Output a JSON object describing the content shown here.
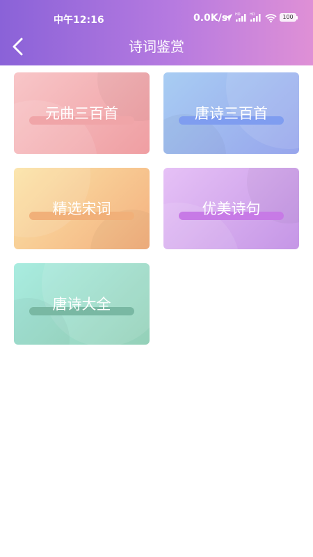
{
  "status_bar": {
    "time": "中午12:16",
    "speed": "0.0K/s",
    "battery": "100"
  },
  "header": {
    "title": "诗词鉴赏",
    "back_icon": "chevron-left-icon"
  },
  "cards": [
    {
      "label": "元曲三百首",
      "bar_color": "#f0a5a8"
    },
    {
      "label": "唐诗三百首",
      "bar_color": "#7f9df0"
    },
    {
      "label": "精选宋词",
      "bar_color": "#f1b079"
    },
    {
      "label": "优美诗句",
      "bar_color": "#c77ae6"
    },
    {
      "label": "唐诗大全",
      "bar_color": "#79b8a3"
    }
  ]
}
